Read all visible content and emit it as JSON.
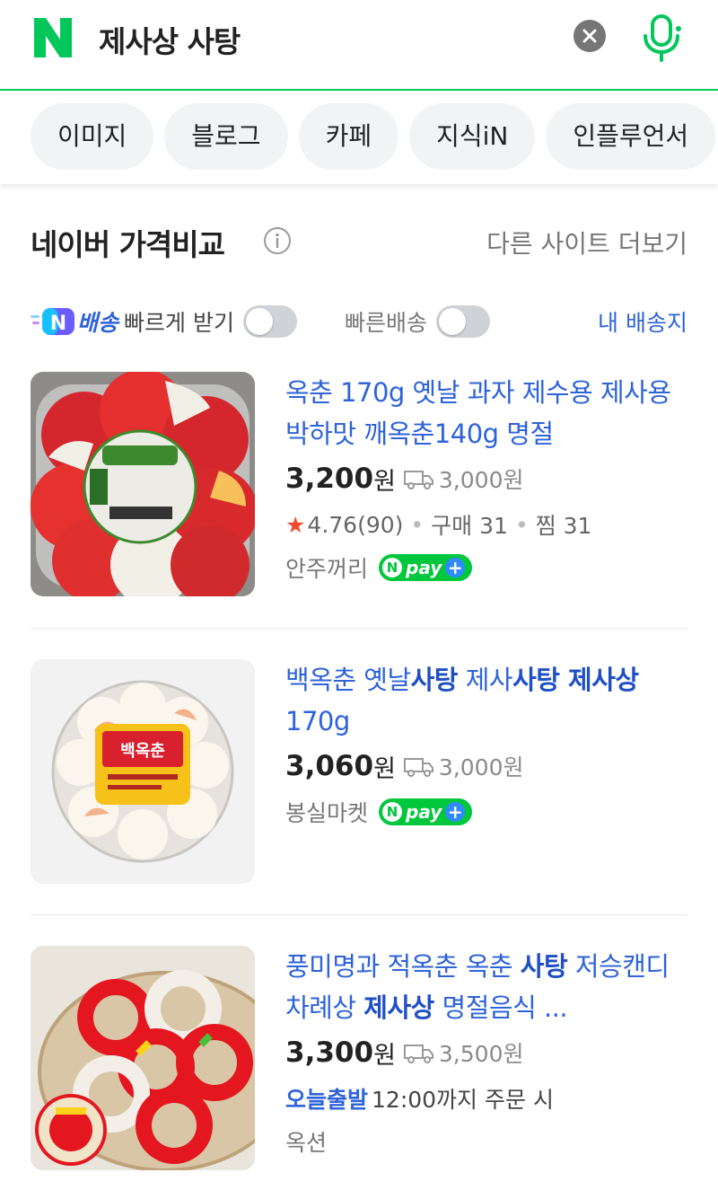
{
  "search": {
    "query": "제사상 사탕"
  },
  "tabs": [
    {
      "label": "이미지"
    },
    {
      "label": "블로그"
    },
    {
      "label": "카페"
    },
    {
      "label": "지식iN"
    },
    {
      "label": "인플루언서"
    }
  ],
  "section": {
    "title": "네이버 가격비교",
    "more_label": "다른 사이트 더보기"
  },
  "filters": {
    "delivery_prefix": "배송",
    "delivery_label": "빠르게 받기",
    "fast_label": "빠른배송",
    "my_address": "내 배송지"
  },
  "products": [
    {
      "title_plain": "옥춘 170g 옛날 과자 제수용 제사용 박하맛 깨옥춘140g 명절",
      "price": "3,200",
      "won": "원",
      "shipping": "3,000원",
      "rating": "4.76",
      "reviews": "(90)",
      "purchases": "구매 31",
      "wishes": "찜 31",
      "seller": "안주꺼리",
      "npay": "pay"
    },
    {
      "title_parts": [
        "백옥춘 옛날",
        "사탕",
        " 제사",
        "사탕 제사상",
        " 170g"
      ],
      "price": "3,060",
      "won": "원",
      "shipping": "3,000원",
      "seller": "봉실마켓",
      "npay": "pay"
    },
    {
      "title_parts": [
        "풍미명과 적옥춘 옥춘 ",
        "사탕",
        " 저승캔디 차례상 ",
        "제사상",
        " 명절음식 ..."
      ],
      "price": "3,300",
      "won": "원",
      "shipping": "3,500원",
      "today_label": "오늘출발",
      "today_rest": "12:00까지 주문 시",
      "seller": "옥션"
    }
  ],
  "colors": {
    "naver_green": "#03c75a",
    "link_blue": "#2e63d9",
    "star_red": "#f04a2c"
  }
}
